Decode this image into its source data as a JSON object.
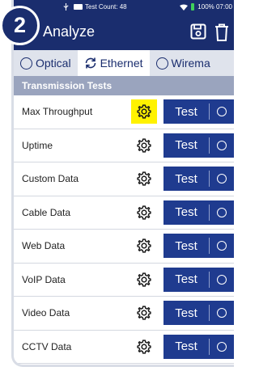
{
  "step_badge": "2",
  "status_bar": {
    "text": "Test Count: 48",
    "battery_text": "100% 07:00"
  },
  "app_bar": {
    "back_glyph": "←",
    "title": "Analyze"
  },
  "tabs": [
    {
      "label": "Optical",
      "active": false
    },
    {
      "label": "Ethernet",
      "active": true
    },
    {
      "label": "Wirema",
      "active": false
    }
  ],
  "section_title": "Transmission Tests",
  "rows": [
    {
      "label": "Max Throughput",
      "button": "Test",
      "highlighted": true
    },
    {
      "label": "Uptime",
      "button": "Test"
    },
    {
      "label": "Custom Data",
      "button": "Test"
    },
    {
      "label": "Cable Data",
      "button": "Test"
    },
    {
      "label": "Web Data",
      "button": "Test"
    },
    {
      "label": "VoIP Data",
      "button": "Test"
    },
    {
      "label": "Video Data",
      "button": "Test"
    },
    {
      "label": "CCTV Data",
      "button": "Test"
    }
  ],
  "colors": {
    "primary": "#1a2d6e",
    "button": "#1f3b8f",
    "highlight": "#fff200",
    "section": "#9aa4be"
  },
  "icons": [
    "usb-icon",
    "battery-icon",
    "wifi-icon",
    "back-arrow-icon",
    "save-icon",
    "trash-icon",
    "gear-icon",
    "sync-icon"
  ]
}
